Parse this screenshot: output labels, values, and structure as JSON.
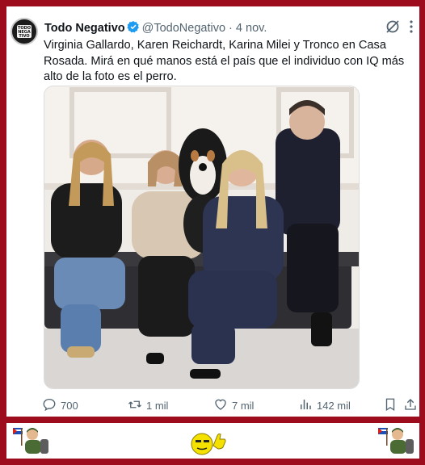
{
  "tweet": {
    "author_name": "Todo Negativo",
    "handle": "@TodoNegativo",
    "separator": "·",
    "date": "4 nov.",
    "avatar_text": "TODO NEGA TIVO",
    "text": "Virginia Gallardo, Karen Reichardt, Karina Milei y Tronco en Casa Rosada. Mirá en qué manos está el país que el individuo con IQ más alto de la foto es el perro."
  },
  "actions": {
    "replies": "700",
    "reposts": "1 mil",
    "likes": "7 mil",
    "views": "142 mil"
  },
  "colors": {
    "frame": "#9c0c1c",
    "verified": "#1d9bf0",
    "text": "#0f1419",
    "muted": "#536471"
  }
}
